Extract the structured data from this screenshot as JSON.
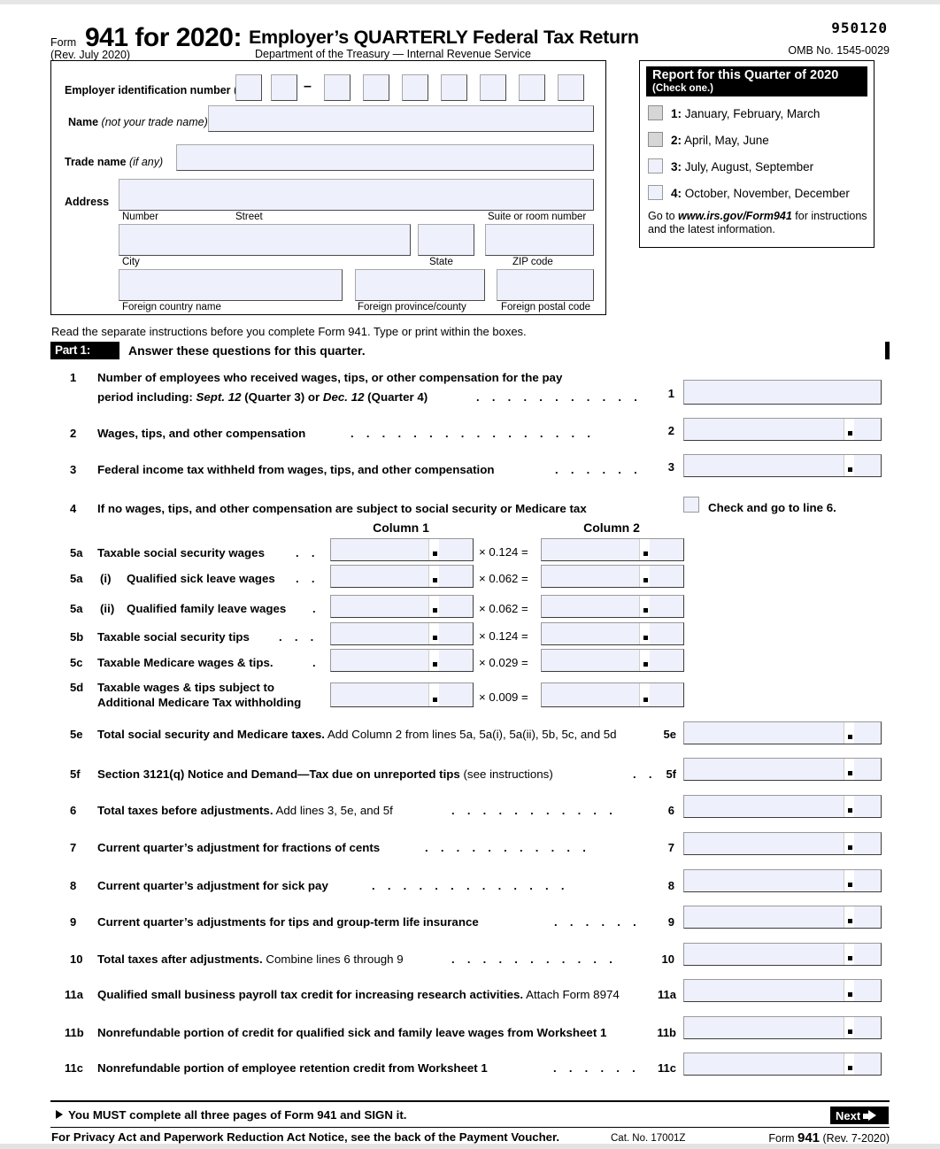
{
  "header": {
    "form_label": "Form",
    "form_number_title": "941 for 2020:",
    "revision": "(Rev. July 2020)",
    "title": "Employer’s QUARTERLY Federal Tax Return",
    "department": "Department of the Treasury — Internal Revenue Service",
    "form_code": "950120",
    "omb": "OMB No. 1545-0029"
  },
  "identity": {
    "ein_label_bold": "Employer identification number",
    "ein_label_paren": "(EIN)",
    "ein_boxes": 9,
    "ein_dash": "–",
    "name_label_bold": "Name",
    "name_label_italic": "(not your trade name)",
    "trade_label_bold": "Trade name",
    "trade_label_italic": "(if any)",
    "address_label": "Address",
    "sub_number": "Number",
    "sub_street": "Street",
    "sub_suite": "Suite or room number",
    "sub_city": "City",
    "sub_state": "State",
    "sub_zip": "ZIP code",
    "sub_foreign_country": "Foreign country name",
    "sub_foreign_province": "Foreign province/county",
    "sub_foreign_postal": "Foreign postal code",
    "values": {
      "name": "",
      "trade_name": "",
      "street": "",
      "suite": "",
      "city": "",
      "state": "",
      "zip": "",
      "foreign_country": "",
      "foreign_province": "",
      "foreign_postal": ""
    }
  },
  "quarter": {
    "title": "Report for this Quarter of 2020",
    "subtitle": "(Check one.)",
    "options": [
      {
        "num": "1:",
        "label": "January, February, March",
        "state": "disabled",
        "checked": false
      },
      {
        "num": "2:",
        "label": "April, May, June",
        "state": "disabled",
        "checked": false
      },
      {
        "num": "3:",
        "label": "July, August, September",
        "state": "active",
        "checked": false
      },
      {
        "num": "4:",
        "label": "October, November, December",
        "state": "active",
        "checked": false
      }
    ],
    "goto_pre": "Go to ",
    "goto_link": "www.irs.gov/Form941",
    "goto_post": " for instructions and the latest information."
  },
  "read_instruction": "Read the separate instructions before you complete Form 941. Type or print within the boxes.",
  "part1": {
    "tag": "Part 1:",
    "heading": "Answer these questions for this quarter."
  },
  "column_headers": {
    "col1": "Column 1",
    "col2": "Column 2"
  },
  "lines": {
    "l1": {
      "no": "1",
      "text_a": "Number of employees who received wages, tips, or other compensation for the pay",
      "text_b_pre": "period  including: ",
      "text_b_i1": "Sept. 12",
      "text_b_m1": " (Quarter 3) or ",
      "text_b_i2": "Dec. 12",
      "text_b_m2": " (Quarter 4)",
      "dots": ". . . . . . . . . . .",
      "rnum": "1",
      "value": ""
    },
    "l2": {
      "no": "2",
      "text": "Wages, tips, and other compensation",
      "dots": ". . . . . . . . . . . . . . . .",
      "rnum": "2",
      "value": ""
    },
    "l3": {
      "no": "3",
      "text": "Federal income tax withheld from wages, tips, and other compensation",
      "dots": ". . . . . .",
      "rnum": "3",
      "value": ""
    },
    "l4": {
      "no": "4",
      "text": "If no wages, tips, and other compensation are subject to social security or Medicare tax",
      "checkbox_label": "Check and go to line 6.",
      "checked": false
    },
    "l5a": {
      "no": "5a",
      "text": "Taxable social security wages",
      "dots": ". .",
      "mult": "× 0.124 =",
      "col1": "",
      "col2": ""
    },
    "l5ai": {
      "no": "5a",
      "sub": "(i)",
      "text": "Qualified sick leave wages",
      "dots": ". .",
      "mult": "× 0.062 =",
      "col1": "",
      "col2": ""
    },
    "l5aii": {
      "no": "5a",
      "sub": "(ii)",
      "text": "Qualified family leave wages",
      "dots": ".",
      "mult": "× 0.062 =",
      "col1": "",
      "col2": ""
    },
    "l5b": {
      "no": "5b",
      "text": "Taxable social security tips",
      "dots": ". . .",
      "mult": "× 0.124 =",
      "col1": "",
      "col2": ""
    },
    "l5c": {
      "no": "5c",
      "text": "Taxable Medicare wages & tips.",
      "dots": ".",
      "mult": "× 0.029 =",
      "col1": "",
      "col2": ""
    },
    "l5d": {
      "no": "5d",
      "text_a": "Taxable wages & tips subject to",
      "text_b": "Additional Medicare Tax withholding",
      "mult": "× 0.009 =",
      "col1": "",
      "col2": ""
    },
    "l5e": {
      "no": "5e",
      "text_bold": "Total social security and Medicare taxes.",
      "text_norm": " Add Column 2 from lines 5a, 5a(i), 5a(ii), 5b, 5c, and 5d",
      "dots": "",
      "rnum": "5e",
      "value": ""
    },
    "l5f": {
      "no": "5f",
      "text_bold": "Section 3121(q) Notice and Demand—Tax due on unreported tips",
      "text_norm": " (see instructions)",
      "dots": ". .",
      "rnum": "5f",
      "value": ""
    },
    "l6": {
      "no": "6",
      "text_bold": "Total taxes before adjustments.",
      "text_norm": " Add lines 3, 5e, and 5f",
      "dots": ". . . . . . . . . . .",
      "rnum": "6",
      "value": ""
    },
    "l7": {
      "no": "7",
      "text_bold": "Current quarter’s adjustment for fractions of cents",
      "text_norm": "",
      "dots": ". . . . . . . . . . .",
      "rnum": "7",
      "value": ""
    },
    "l8": {
      "no": "8",
      "text_bold": "Current quarter’s adjustment for sick pay",
      "text_norm": "",
      "dots": ". . . . . . . . . . . . .",
      "rnum": "8",
      "value": ""
    },
    "l9": {
      "no": "9",
      "text_bold": "Current quarter’s adjustments for tips and group-term life insurance",
      "text_norm": "",
      "dots": ". . . . . .",
      "rnum": "9",
      "value": ""
    },
    "l10": {
      "no": "10",
      "text_bold": "Total taxes after adjustments.",
      "text_norm": " Combine lines 6 through 9",
      "dots": ". . . . . . . . . . .",
      "rnum": "10",
      "value": ""
    },
    "l11a": {
      "no": "11a",
      "text_bold": "Qualified small business payroll tax credit for increasing research activities.",
      "text_norm": " Attach Form 8974",
      "dots": "",
      "rnum": "11a",
      "value": ""
    },
    "l11b": {
      "no": "11b",
      "text_bold": "Nonrefundable portion of credit for qualified sick and family leave wages from Worksheet 1",
      "text_norm": "",
      "dots": "",
      "rnum": "11b",
      "value": ""
    },
    "l11c": {
      "no": "11c",
      "text_bold": "Nonrefundable portion of employee retention credit from Worksheet 1",
      "text_norm": "",
      "dots": ". . . . . .",
      "rnum": "11c",
      "value": ""
    }
  },
  "footer": {
    "must_text": "You MUST complete all three pages of Form 941 and SIGN it.",
    "next_label": "Next",
    "privacy": "For Privacy Act and Paperwork Reduction Act Notice, see the back of the Payment Voucher.",
    "cat_no": "Cat. No. 17001Z",
    "form_pre": "Form ",
    "form_num": "941",
    "form_rev": " (Rev. 7-2020)"
  },
  "colors": {
    "field_fill": "#eef0fb",
    "disabled_fill": "#d6d6d6",
    "bar_black": "#000000"
  }
}
